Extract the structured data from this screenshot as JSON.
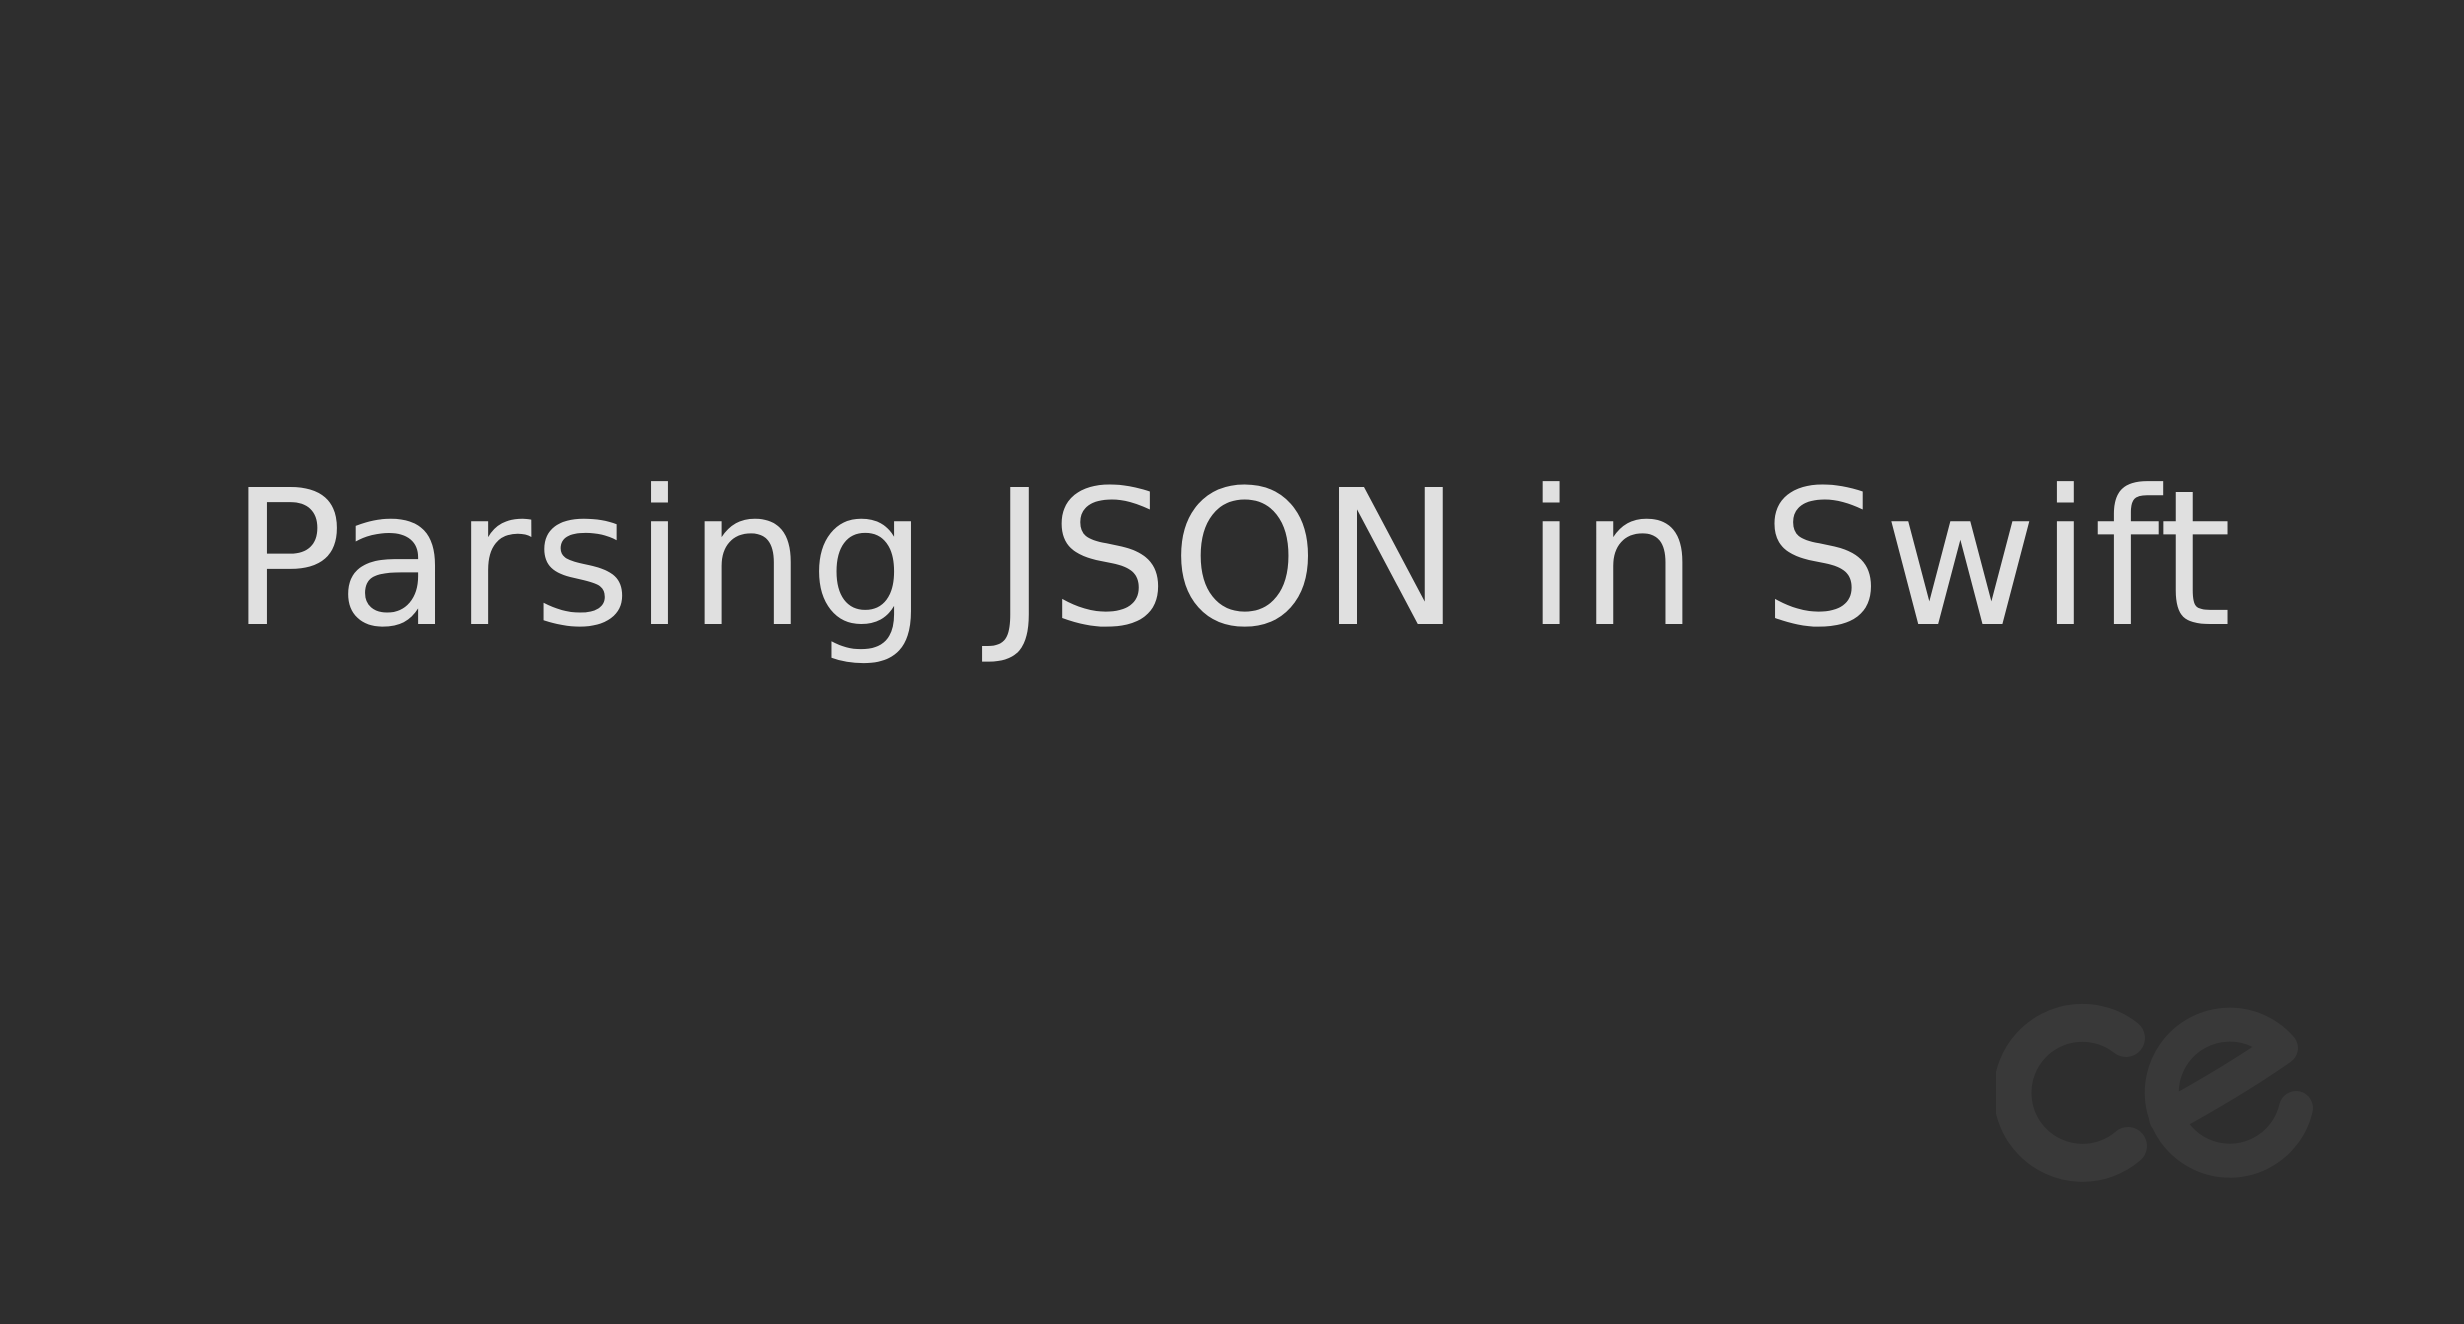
{
  "title": "Parsing JSON in Swift",
  "logo": {
    "icon": "ce-logo-icon",
    "color": "#393939"
  },
  "colors": {
    "background": "#2e2e2e",
    "text": "#e0e0e0"
  }
}
